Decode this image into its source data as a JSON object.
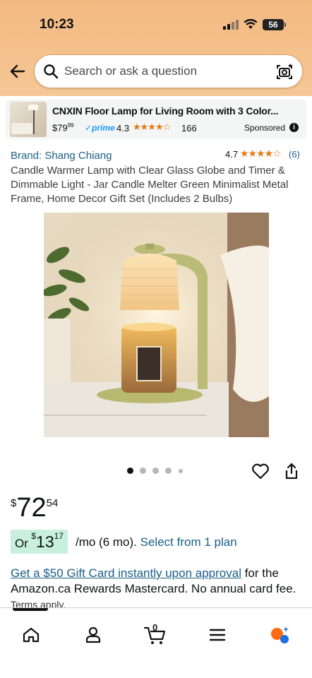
{
  "status_bar": {
    "time": "10:23",
    "battery": "56"
  },
  "search": {
    "placeholder": "Search or ask a question"
  },
  "sponsored_ad": {
    "title": "CNXIN Floor Lamp for Living Room with 3 Color...",
    "price_whole": "$79",
    "price_fraction": "99",
    "prime_label": "prime",
    "rating": "4.3",
    "stars": "★★★★☆",
    "review_count": "166",
    "sponsored_label": "Sponsored",
    "info_glyph": "i"
  },
  "product": {
    "brand": "Brand: Shang Chiang",
    "rating": "4.7",
    "stars": "★★★★☆",
    "review_count": "(6)",
    "title": "Candle Warmer Lamp with Clear Glass Globe and Timer & Dimmable Light - Jar Candle Melter Green Minimalist Metal Frame, Home Decor Gift Set (Includes 2 Bulbs)",
    "image_count": 5,
    "active_image": 1
  },
  "price": {
    "currency": "$",
    "whole": "72",
    "fraction": "54"
  },
  "monthly": {
    "or_label": "Or",
    "currency": "$",
    "whole": "13",
    "fraction": "17",
    "per_month": "/mo (6 mo).",
    "select_plan": "Select from 1 plan"
  },
  "gift_card": {
    "link": "Get a $50 Gift Card instantly upon approval",
    "text": " for the Amazon.ca Rewards Mastercard. No annual card fee.",
    "terms": "Terms apply."
  },
  "bottom_nav": {
    "cart_count": "0"
  },
  "colors": {
    "accent_link": "#1b5f87",
    "header_bg": "#f3b981",
    "star": "#e47911",
    "installment_bg": "#c8f0dc"
  }
}
